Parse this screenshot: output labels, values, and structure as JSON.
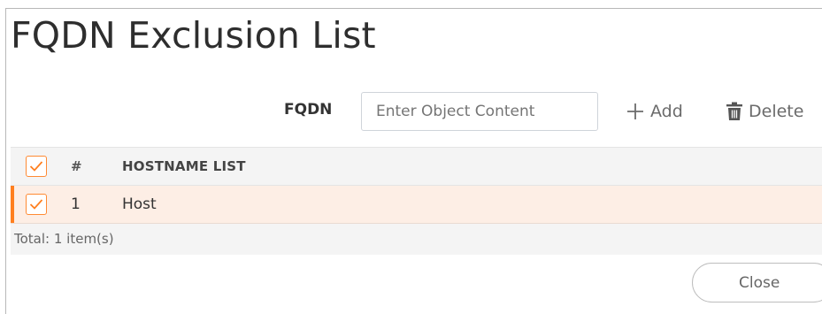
{
  "dialog": {
    "title": "FQDN Exclusion List"
  },
  "toolbar": {
    "field_label": "FQDN",
    "input_placeholder": "Enter Object Content",
    "input_value": "",
    "add_label": "Add",
    "delete_label": "Delete"
  },
  "table": {
    "columns": {
      "number": "#",
      "hostname": "HOSTNAME LIST"
    },
    "header_checked": true,
    "rows": [
      {
        "number": "1",
        "hostname": "Host",
        "checked": true,
        "selected": true
      }
    ],
    "total": "Total: 1 item(s)"
  },
  "footer": {
    "close_label": "Close"
  },
  "icons": {
    "add": "plus-icon",
    "delete": "trash-icon",
    "check": "checkmark-icon"
  },
  "colors": {
    "accent": "#ff7f1f",
    "selected_row_bg": "#fdeee5",
    "header_bg": "#f4f4f4"
  }
}
